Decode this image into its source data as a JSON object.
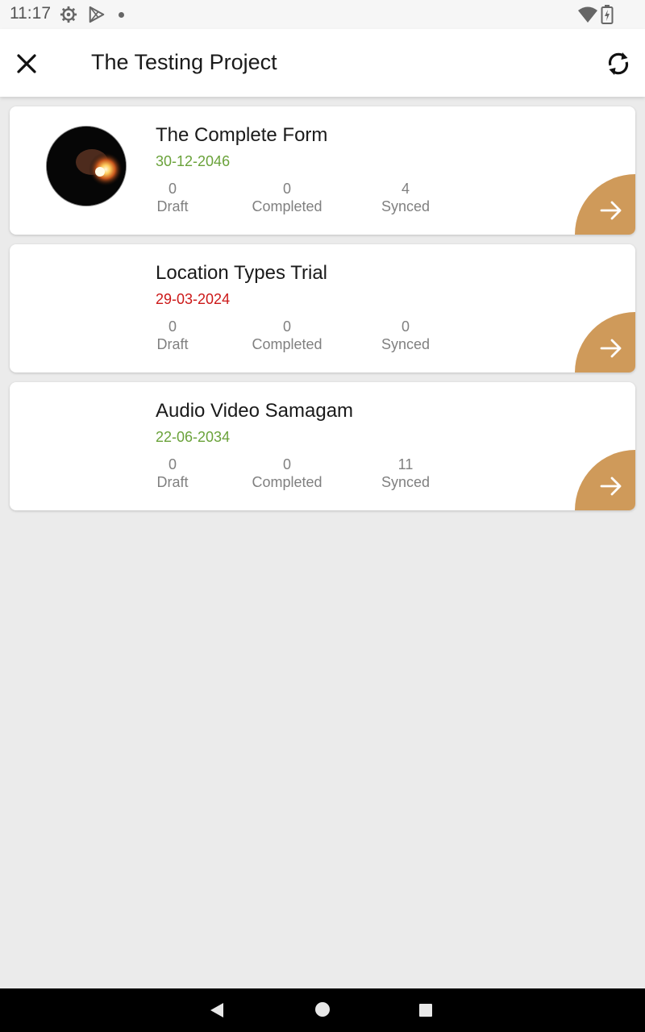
{
  "status_bar": {
    "time": "11:17",
    "icons": [
      "gear-icon",
      "play-store-icon",
      "notification-dot-icon",
      "wifi-icon",
      "battery-charging-icon"
    ]
  },
  "app_bar": {
    "title": "The Testing Project",
    "close_icon": "close-icon",
    "sync_icon": "sync-icon"
  },
  "colors": {
    "accent": "#cf9a5a",
    "date_ok": "#6aa23a",
    "date_expired": "#cc1818",
    "background": "#ebebeb"
  },
  "forms": [
    {
      "title": "The Complete Form",
      "date": "30-12-2046",
      "date_status": "green",
      "has_image": true,
      "stats": [
        {
          "value": "0",
          "label": "Draft"
        },
        {
          "value": "0",
          "label": "Completed"
        },
        {
          "value": "4",
          "label": "Synced"
        }
      ]
    },
    {
      "title": "Location Types Trial",
      "date": "29-03-2024",
      "date_status": "red",
      "has_image": false,
      "stats": [
        {
          "value": "0",
          "label": "Draft"
        },
        {
          "value": "0",
          "label": "Completed"
        },
        {
          "value": "0",
          "label": "Synced"
        }
      ]
    },
    {
      "title": "Audio Video Samagam",
      "date": "22-06-2034",
      "date_status": "green",
      "has_image": false,
      "stats": [
        {
          "value": "0",
          "label": "Draft"
        },
        {
          "value": "0",
          "label": "Completed"
        },
        {
          "value": "11",
          "label": "Synced"
        }
      ]
    }
  ],
  "nav_bar": {
    "icons": [
      "back-icon",
      "home-icon",
      "recents-icon"
    ]
  }
}
